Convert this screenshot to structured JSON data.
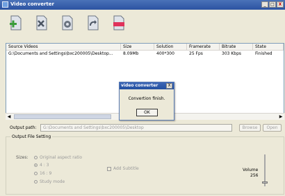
{
  "window": {
    "title": "Video converter",
    "minimize_label": "_",
    "maximize_label": "□",
    "close_label": "X"
  },
  "toolbar": [
    {
      "name": "add-video-icon"
    },
    {
      "name": "remove-video-icon"
    },
    {
      "name": "settings-icon"
    },
    {
      "name": "convert-icon"
    },
    {
      "name": "clear-icon"
    }
  ],
  "list": {
    "headers": [
      "Source Videos",
      "Size",
      "Solution",
      "Framerate",
      "Bitrate",
      "State"
    ],
    "rows": [
      [
        "G:\\Documents and Settings\\bxc200005\\Desktop...",
        "8.09Mb",
        "400*300",
        "25 Fps",
        "303 Kbps",
        "Finished"
      ]
    ]
  },
  "scroll": {
    "left": "◀",
    "right": "▶"
  },
  "output": {
    "path_label": "Output path:",
    "path_value": "G:\\Documents and Settings\\bxc200005\\Desktop",
    "browse_label": "Browse",
    "open_label": "Open"
  },
  "settings": {
    "legend": "Output File Setting",
    "sizes_label": "Sizes:",
    "options": [
      "Original aspect ratio",
      "4 : 3",
      "16 : 9",
      "Study mode"
    ],
    "selected_option": "4 : 3",
    "subtitle_label": "Add Subtitle",
    "volume_label": "Volume",
    "volume_value": "256"
  },
  "dialog": {
    "title": "video converter",
    "close_label": "X",
    "message": "Convertion finish.",
    "ok_label": "OK"
  }
}
